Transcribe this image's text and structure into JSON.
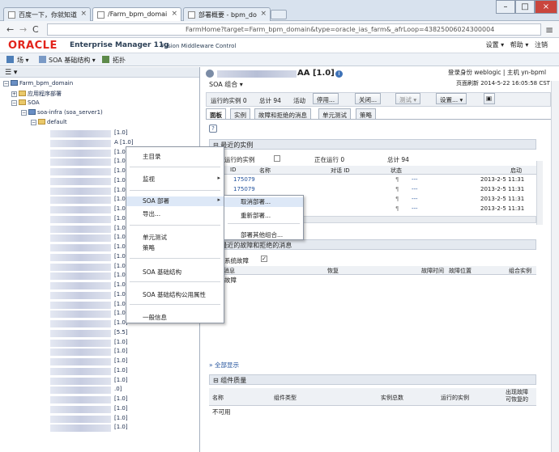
{
  "browser": {
    "tabs": [
      {
        "title": "百度一下，你就知道"
      },
      {
        "title": "/Farm_bpm_domai"
      },
      {
        "title": "部署概要 - bpm_do"
      }
    ],
    "url": "FarmHome?target=Farm_bpm_domain&type=oracle_ias_farm&_afrLoop=43825006024300004"
  },
  "brand": {
    "oracle": "ORACLE",
    "product": "Enterprise Manager 11g",
    "sub": "Fusion Middleware Control"
  },
  "top_links": {
    "settings": "设置 ▾",
    "help": "帮助 ▾",
    "logout": "注销"
  },
  "toolbar": {
    "farm": "场 ▾",
    "soa": "SOA 基础结构 ▾",
    "topology": "拓扑"
  },
  "tree": {
    "domain": "Farm_bpm_domain",
    "apps": "应用程序部署",
    "soa": "SOA",
    "infra": "soa-infra (soa_server1)",
    "default": "default",
    "versions": [
      "[1.0]",
      "A [1.0]",
      "[1.0]",
      "[1.0]",
      "[1.0]",
      "[1.0]",
      "[1.0]",
      "[1.0]",
      "[1.0]",
      "[1.0]",
      "[1.0]",
      "[1.0]",
      "[1.0]",
      "[1.0]",
      "[1.0]",
      "[1.0]",
      "[1.0]",
      "[1.0]",
      "[1.0]",
      "[1.0]",
      "[1.0]",
      "[5.5]",
      "[1.0]",
      "[1.0]",
      "[1.0]",
      "[1.0]",
      "[1.0]",
      ".0]",
      "[1.0]",
      "[1.0]",
      "[1.0]",
      "[1.0]"
    ]
  },
  "context_menu": {
    "items": [
      "主目录",
      "监视",
      "SOA 部署",
      "导出...",
      "单元测试",
      "策略",
      "SOA 基础结构",
      "SOA 基础结构公用属性",
      "一般信息"
    ],
    "submenu": [
      "取消部署...",
      "重新部署...",
      "部署其他组合..."
    ]
  },
  "composite": {
    "title": "AA [1.0]",
    "menu": "SOA 组合 ▾",
    "login": "登录身份 weblogic | 主机 yn-bpml",
    "refresh": "页面刷新 2014-5-22 16:05:58 CST",
    "running_label": "运行的实例",
    "running": "0",
    "total_label": "总计",
    "total": "94",
    "active": "活动",
    "buttons": [
      "停用...",
      "关闭...",
      "测试 ▾",
      "设置... ▾"
    ],
    "tabs": [
      "面板",
      "实例",
      "故障和拒绝的消息",
      "单元测试",
      "策略"
    ]
  },
  "recent": {
    "title": "最近的实例",
    "show_running": "显示运行的实例",
    "now_running_label": "正在运行",
    "now_running": "0",
    "total_label": "总计",
    "total": "94",
    "columns": [
      "ID",
      "名称",
      "对话 ID",
      "状态",
      "",
      "启动"
    ],
    "rows": [
      {
        "id": "175079",
        "status": "---",
        "start": "2013-2-5 11:31"
      },
      {
        "id": "175079",
        "status": "---",
        "start": "2013-2-5 11:31"
      },
      {
        "id": "",
        "status": "---",
        "start": "2013-2-5 11:31"
      },
      {
        "id": "",
        "status": "---",
        "start": "2013-2-5 11:31"
      }
    ]
  },
  "faults": {
    "title": "最近的故障和拒绝的消息",
    "show_system": "显示系统故障",
    "columns": [
      "错误消息",
      "恢复",
      "故障时间",
      "故障位置",
      "组合实例"
    ],
    "empty": "没有故障",
    "show_all": "全部显示"
  },
  "quality": {
    "title": "组件质量",
    "columns": [
      "名称",
      "组件类型",
      "实例总数",
      "运行的实例",
      "出现故障\n可恢复的"
    ],
    "empty": "不可用"
  },
  "colors": {
    "oracle_red": "#e2231a",
    "accent": "#1f4f9a"
  }
}
